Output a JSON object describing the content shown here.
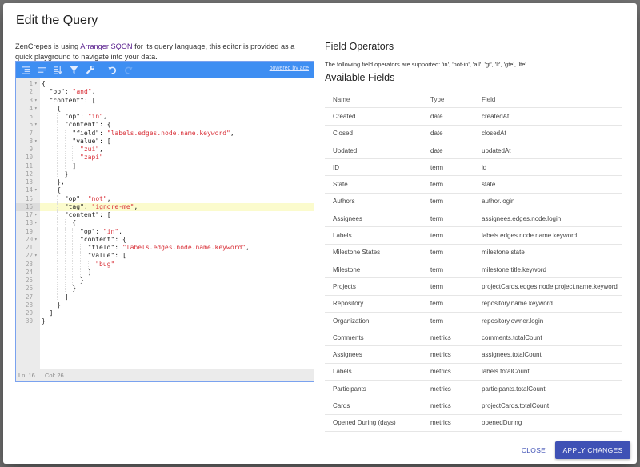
{
  "dialog": {
    "title": "Edit the Query",
    "intro_prefix": "ZenCrepes is using ",
    "intro_link": "Arranger SQON",
    "intro_suffix": " for its query language, this editor is provided as a quick playground to navigate into your data."
  },
  "editor": {
    "toolbar": {
      "icons": [
        "format-indent-icon",
        "format-align-icon",
        "sort-icon",
        "filter-icon",
        "wrench-icon",
        "undo-icon",
        "redo-icon"
      ],
      "powered_by": "powered by ace"
    },
    "active_line": 16,
    "fold_lines": [
      1,
      3,
      4,
      6,
      8,
      14,
      17,
      18,
      20,
      22
    ],
    "lines": [
      {
        "indent": 0,
        "parts": [
          [
            "p",
            "{"
          ]
        ]
      },
      {
        "indent": 1,
        "parts": [
          [
            "p",
            "\"op\": "
          ],
          [
            "s",
            "\"and\""
          ],
          [
            "p",
            ","
          ]
        ]
      },
      {
        "indent": 1,
        "parts": [
          [
            "p",
            "\"content\": ["
          ]
        ]
      },
      {
        "indent": 2,
        "parts": [
          [
            "p",
            "{"
          ]
        ]
      },
      {
        "indent": 3,
        "parts": [
          [
            "p",
            "\"op\": "
          ],
          [
            "s",
            "\"in\""
          ],
          [
            "p",
            ","
          ]
        ]
      },
      {
        "indent": 3,
        "parts": [
          [
            "p",
            "\"content\": {"
          ]
        ]
      },
      {
        "indent": 4,
        "parts": [
          [
            "p",
            "\"field\": "
          ],
          [
            "s",
            "\"labels.edges.node.name.keyword\""
          ],
          [
            "p",
            ","
          ]
        ]
      },
      {
        "indent": 4,
        "parts": [
          [
            "p",
            "\"value\": ["
          ]
        ]
      },
      {
        "indent": 5,
        "parts": [
          [
            "s",
            "\"zui\""
          ],
          [
            "p",
            ","
          ]
        ]
      },
      {
        "indent": 5,
        "parts": [
          [
            "s",
            "\"zapi\""
          ]
        ]
      },
      {
        "indent": 4,
        "parts": [
          [
            "p",
            "]"
          ]
        ]
      },
      {
        "indent": 3,
        "parts": [
          [
            "p",
            "}"
          ]
        ]
      },
      {
        "indent": 2,
        "parts": [
          [
            "p",
            "},"
          ]
        ]
      },
      {
        "indent": 2,
        "parts": [
          [
            "p",
            "{"
          ]
        ]
      },
      {
        "indent": 3,
        "parts": [
          [
            "p",
            "\"op\": "
          ],
          [
            "s",
            "\"not\""
          ],
          [
            "p",
            ","
          ]
        ]
      },
      {
        "indent": 3,
        "parts": [
          [
            "p",
            "\"tag\": "
          ],
          [
            "s",
            "\"ignore-me\""
          ],
          [
            "p",
            ","
          ]
        ]
      },
      {
        "indent": 3,
        "parts": [
          [
            "p",
            "\"content\": ["
          ]
        ]
      },
      {
        "indent": 4,
        "parts": [
          [
            "p",
            "{"
          ]
        ]
      },
      {
        "indent": 5,
        "parts": [
          [
            "p",
            "\"op\": "
          ],
          [
            "s",
            "\"in\""
          ],
          [
            "p",
            ","
          ]
        ]
      },
      {
        "indent": 5,
        "parts": [
          [
            "p",
            "\"content\": {"
          ]
        ]
      },
      {
        "indent": 6,
        "parts": [
          [
            "p",
            "\"field\": "
          ],
          [
            "s",
            "\"labels.edges.node.name.keyword\""
          ],
          [
            "p",
            ","
          ]
        ]
      },
      {
        "indent": 6,
        "parts": [
          [
            "p",
            "\"value\": ["
          ]
        ]
      },
      {
        "indent": 7,
        "parts": [
          [
            "s",
            "\"bug\""
          ]
        ]
      },
      {
        "indent": 6,
        "parts": [
          [
            "p",
            "]"
          ]
        ]
      },
      {
        "indent": 5,
        "parts": [
          [
            "p",
            "}"
          ]
        ]
      },
      {
        "indent": 4,
        "parts": [
          [
            "p",
            "}"
          ]
        ]
      },
      {
        "indent": 3,
        "parts": [
          [
            "p",
            "]"
          ]
        ]
      },
      {
        "indent": 2,
        "parts": [
          [
            "p",
            "}"
          ]
        ]
      },
      {
        "indent": 1,
        "parts": [
          [
            "p",
            "]"
          ]
        ]
      },
      {
        "indent": 0,
        "parts": [
          [
            "p",
            "}"
          ]
        ]
      }
    ],
    "status": {
      "line": "Ln: 16",
      "col": "Col: 26"
    }
  },
  "operators": {
    "heading": "Field Operators",
    "text": "The following field operators are supported: 'in', 'not-in', 'all', 'gt', 'lt', 'gte', 'lte'"
  },
  "fields": {
    "heading": "Available Fields",
    "columns": [
      "Name",
      "Type",
      "Field"
    ],
    "rows": [
      [
        "Created",
        "date",
        "createdAt"
      ],
      [
        "Closed",
        "date",
        "closedAt"
      ],
      [
        "Updated",
        "date",
        "updatedAt"
      ],
      [
        "ID",
        "term",
        "id"
      ],
      [
        "State",
        "term",
        "state"
      ],
      [
        "Authors",
        "term",
        "author.login"
      ],
      [
        "Assignees",
        "term",
        "assignees.edges.node.login"
      ],
      [
        "Labels",
        "term",
        "labels.edges.node.name.keyword"
      ],
      [
        "Milestone States",
        "term",
        "milestone.state"
      ],
      [
        "Milestone",
        "term",
        "milestone.title.keyword"
      ],
      [
        "Projects",
        "term",
        "projectCards.edges.node.project.name.keyword"
      ],
      [
        "Repository",
        "term",
        "repository.name.keyword"
      ],
      [
        "Organization",
        "term",
        "repository.owner.login"
      ],
      [
        "Comments",
        "metrics",
        "comments.totalCount"
      ],
      [
        "Assignees",
        "metrics",
        "assignees.totalCount"
      ],
      [
        "Labels",
        "metrics",
        "labels.totalCount"
      ],
      [
        "Participants",
        "metrics",
        "participants.totalCount"
      ],
      [
        "Cards",
        "metrics",
        "projectCards.totalCount"
      ],
      [
        "Opened During (days)",
        "metrics",
        "openedDuring"
      ]
    ]
  },
  "actions": {
    "close_label": "CLOSE",
    "apply_label": "APPLY CHANGES"
  },
  "colors": {
    "toolbar": "#3e8ef2",
    "primary": "#3f51b5",
    "string": "#d9323a",
    "active_line": "#fbfbcd"
  }
}
